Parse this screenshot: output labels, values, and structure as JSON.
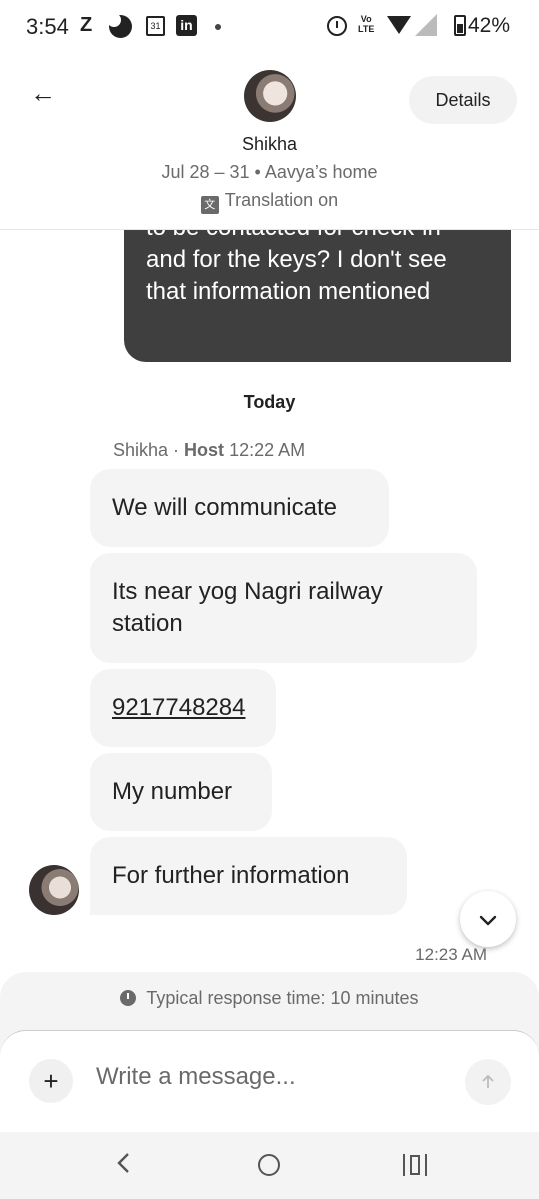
{
  "status_bar": {
    "time": "3:54",
    "z_label": "Z",
    "calendar_day": "31",
    "linkedin_label": "in",
    "lte_top": "Vo",
    "lte_bottom": "LTE",
    "battery": "42%"
  },
  "header": {
    "back_icon": "arrow-left-icon",
    "details_label": "Details",
    "host_name": "Shikha",
    "trip_info": "Jul 28 – 31 • Aavya’s home",
    "translation_icon": "translate-icon",
    "translation_status": "Translation on"
  },
  "conversation": {
    "outgoing_message": {
      "lines": [
        "to be contacted for check-in",
        "and for the keys? I don't see",
        "that information mentioned"
      ]
    },
    "day_separator": "Today",
    "sender_name": "Shikha",
    "sender_role": "Host",
    "sender_time": "12:22 AM",
    "incoming_messages": [
      "We will communicate",
      "Its near yog Nagri railway station",
      "9217748284",
      "My number",
      "For further information"
    ],
    "last_message_time": "12:23 AM",
    "scroll_icon": "chevron-down-icon"
  },
  "footer": {
    "response_time": "Typical response time: 10 minutes",
    "clock_icon": "clock-icon",
    "add_icon": "plus-icon",
    "input_placeholder": "Write a message...",
    "send_icon": "arrow-up-icon"
  },
  "nav_bar": {
    "back_icon": "nav-back-icon",
    "home_icon": "nav-home-icon",
    "recents_icon": "nav-recents-icon"
  }
}
